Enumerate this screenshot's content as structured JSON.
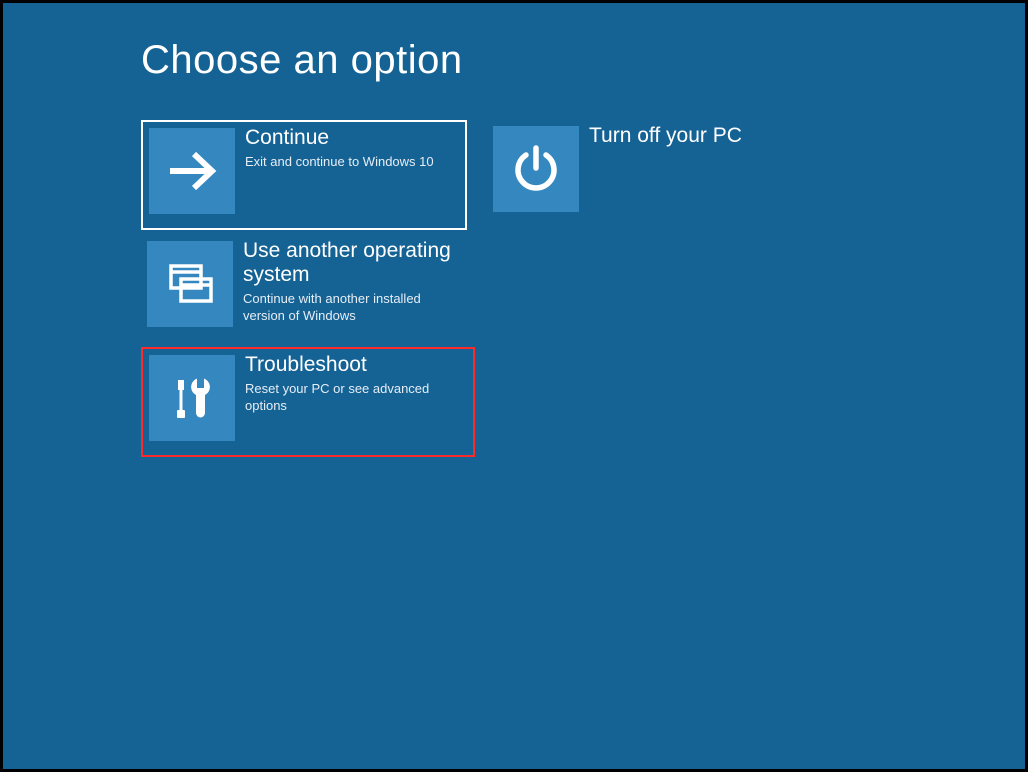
{
  "title": "Choose an option",
  "tiles": {
    "continue": {
      "label": "Continue",
      "desc": "Exit and continue to Windows 10"
    },
    "poweroff": {
      "label": "Turn off your PC",
      "desc": ""
    },
    "another_os": {
      "label": "Use another operating system",
      "desc": "Continue with another installed version of Windows"
    },
    "troubleshoot": {
      "label": "Troubleshoot",
      "desc": "Reset your PC or see advanced options"
    }
  }
}
